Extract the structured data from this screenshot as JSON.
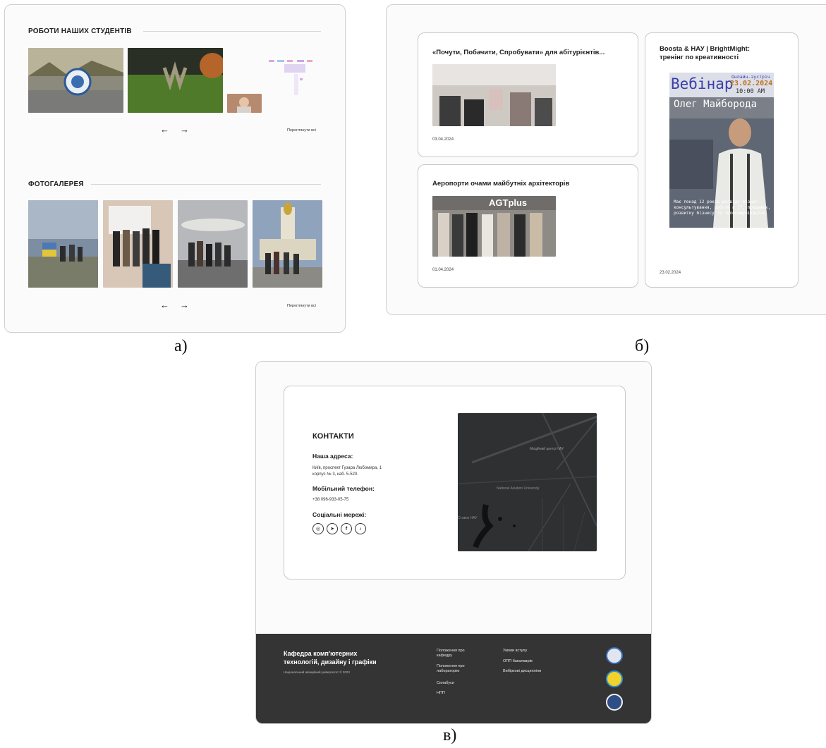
{
  "panel_a": {
    "students_title": "РОБОТИ НАШИХ СТУДЕНТІВ",
    "gallery_title": "ФОТОГАЛЕРЕЯ",
    "arrow_prev": "←",
    "arrow_next": "→",
    "see_all": "Переглянути всі"
  },
  "panel_b": {
    "cards": [
      {
        "title": "«Почути, Побачити, Спробувати» для абітурієнтів...",
        "date": "03.04.2024"
      },
      {
        "title": "Аеропорти очами майбутніх архітекторів",
        "date": "01.04.2024",
        "image_text": "AGTplus"
      },
      {
        "title": "Boosta & НАУ | BrightMight: тренінг по креативності",
        "date": "23.02.2024"
      }
    ],
    "poster": {
      "heading": "Вебінар",
      "subheading": "Онлайн-зустріч",
      "date": "23.02.2024",
      "time": "10:00 AM",
      "speaker": "Олег Майборода",
      "text": "Має понад 12 років досвіду бізнес-консультування, роботи в IT, продажах, розвитку бізнесу та телекомунікаціях."
    }
  },
  "panel_c": {
    "heading": "КОНТАКТИ",
    "address_label": "Наша адреса:",
    "address_line1": "Київ, проспект Гузара Любомира, 1",
    "address_line2": "корпус № 3, каб. 5-520.",
    "phone_label": "Мобільний телефон:",
    "phone": "+38 096-933-05-75",
    "social_label": "Соціальні мережі:",
    "social_icons": [
      "instagram-icon",
      "telegram-icon",
      "facebook-icon",
      "tiktok-icon"
    ],
    "map_labels": {
      "university": "National Aviation University",
      "center": "Медійний центр НАУ",
      "pond": "Ставок НАУ"
    },
    "footer": {
      "title_line1": "Кафедра комп'ютерних",
      "title_line2": "технологій, дизайну і графіки",
      "copyright": "Національний авіаційний університет © 2023",
      "col1": [
        "Положення про кафедру",
        "Положення про лабораторію",
        "Силабуси",
        "НПП"
      ],
      "col2": [
        "Умови вступу",
        "ОПП бакалаврів",
        "Вибіркові дисципліни"
      ]
    }
  },
  "captions": {
    "a": "а)",
    "b": "б)",
    "c": "в)"
  },
  "colors": {
    "footer_bg": "#343434",
    "map_bg": "#2f3032",
    "page_bg": "#fbfbfb"
  }
}
